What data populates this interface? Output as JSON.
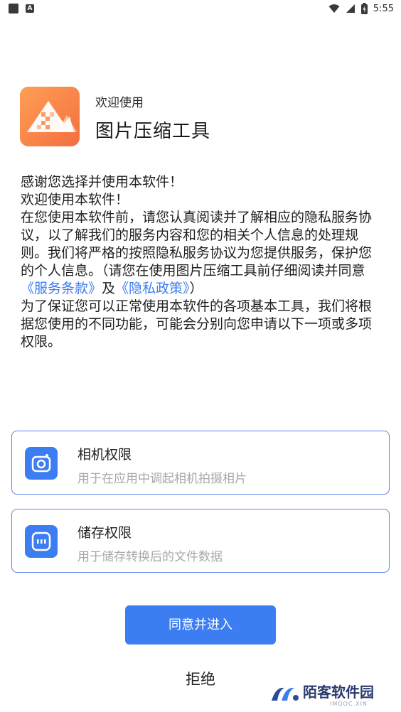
{
  "status_bar": {
    "time": "5:55",
    "notification_icon": "A"
  },
  "header": {
    "welcome": "欢迎使用",
    "app_name": "图片压缩工具"
  },
  "intro": {
    "line1": "感谢您选择并使用本软件！",
    "line2": "欢迎使用本软件！",
    "para_main": "在您使用本软件前，请您认真阅读并了解相应的隐私服务协议，以了解我们的服务内容和您的相关个人信息的处理规则。我们将严格的按照隐私服务协议为您提供服务，保护您的个人信息。（请您在使用图片压缩工具前仔细阅读并同意",
    "terms_link": "《服务条款》",
    "and": "及",
    "privacy_link": "《隐私政策》",
    "close_paren": "）",
    "para_perm": "为了保证您可以正常使用本软件的各项基本工具，我们将根据您使用的不同功能，可能会分别向您申请以下一项或多项权限。"
  },
  "permissions": [
    {
      "title": "相机权限",
      "desc": "用于在应用中调起相机拍摄相片",
      "icon": "camera-icon"
    },
    {
      "title": "储存权限",
      "desc": "用于储存转换后的文件数据",
      "icon": "storage-icon"
    }
  ],
  "buttons": {
    "agree": "同意并进入",
    "reject": "拒绝"
  },
  "watermark": {
    "text": "陌客软件园",
    "sub": "IMOOC.XIN"
  },
  "colors": {
    "accent": "#3d7df2",
    "logo": "#f47b43",
    "link": "#3b7cf0"
  }
}
